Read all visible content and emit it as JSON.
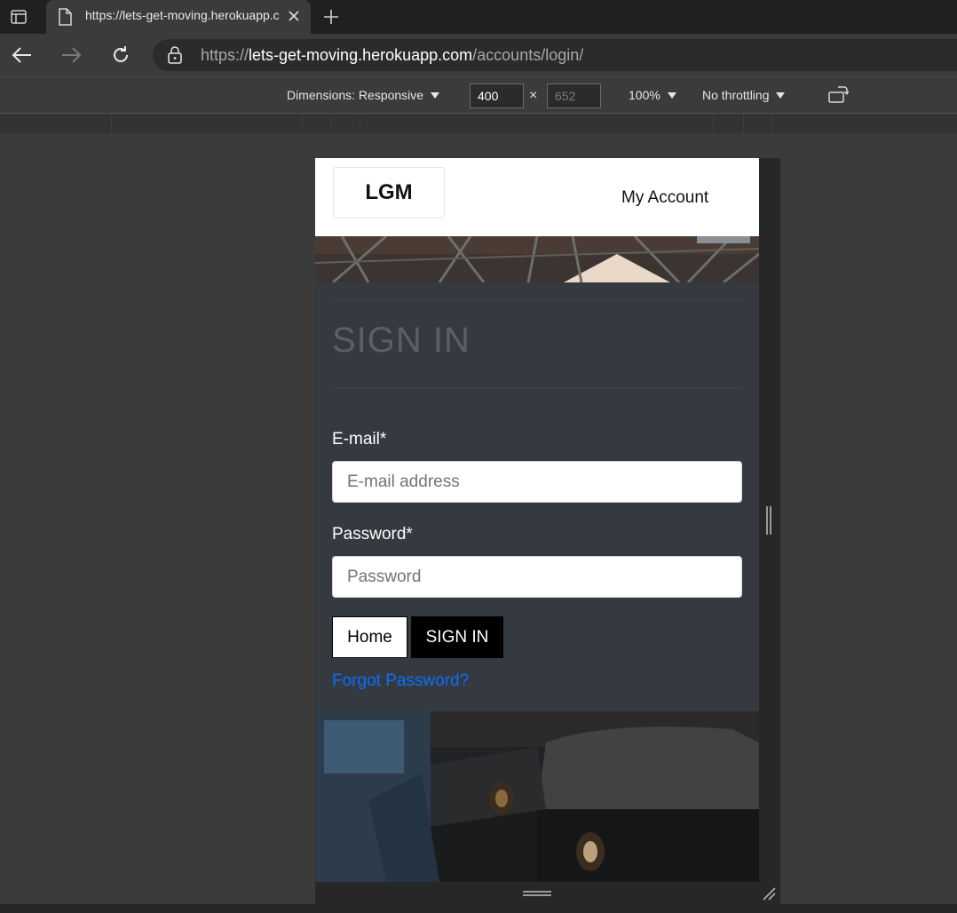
{
  "browser": {
    "tab_title": "https://lets-get-moving.herokuapp.com/accounts/login/",
    "url_scheme": "https://",
    "url_host": "lets-get-moving.herokuapp.com",
    "url_path": "/accounts/login/"
  },
  "devtools": {
    "dimensions_label": "Dimensions: Responsive",
    "width_value": "400",
    "height_placeholder": "652",
    "times_symbol": "×",
    "zoom": "100%",
    "throttling": "No throttling"
  },
  "site": {
    "logo": "LGM",
    "nav_account": "My Account",
    "page_title": "SIGN IN",
    "email_label": "E-mail*",
    "email_placeholder": "E-mail address",
    "password_label": "Password*",
    "password_placeholder": "Password",
    "home_button": "Home",
    "signin_button": "SIGN IN",
    "forgot_link": "Forgot Password?"
  },
  "colors": {
    "panel_bg": "#343a40",
    "link": "#0d6efd",
    "browser_chrome": "#202020"
  }
}
